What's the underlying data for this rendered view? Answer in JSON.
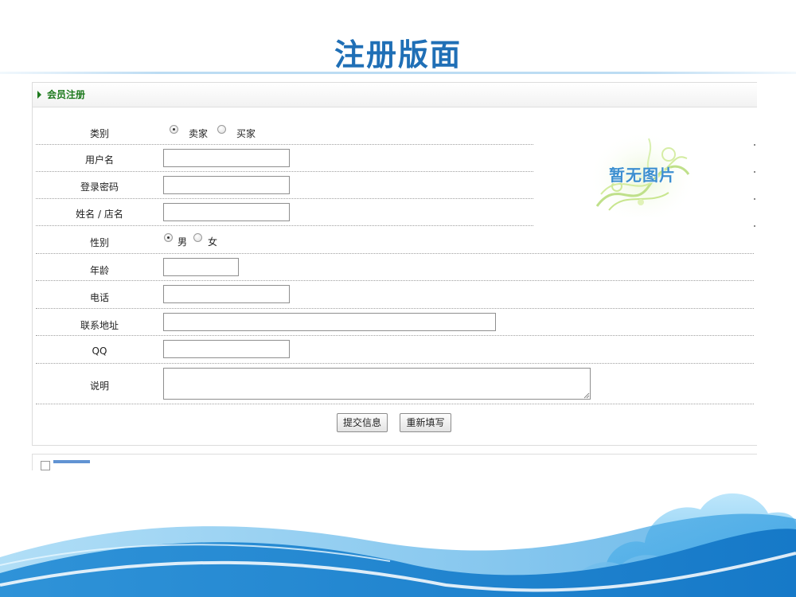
{
  "slide": {
    "title": "注册版面"
  },
  "panel": {
    "header": "会员注册"
  },
  "form": {
    "category": {
      "label": "类别",
      "options": [
        "卖家",
        "买家"
      ],
      "selected": "卖家"
    },
    "username": {
      "label": "用户名",
      "value": ""
    },
    "password": {
      "label": "登录密码",
      "value": ""
    },
    "name": {
      "label": "姓名 / 店名",
      "value": ""
    },
    "gender": {
      "label": "性别",
      "options": [
        "男",
        "女"
      ],
      "selected": "男"
    },
    "age": {
      "label": "年龄",
      "value": ""
    },
    "phone": {
      "label": "电话",
      "value": ""
    },
    "address": {
      "label": "联系地址",
      "value": ""
    },
    "qq": {
      "label": "QQ",
      "value": ""
    },
    "description": {
      "label": "说明",
      "value": ""
    },
    "submit_label": "提交信息",
    "reset_label": "重新填写"
  },
  "image_placeholder": {
    "text": "暂无图片"
  },
  "colors": {
    "title": "#1f6fb6",
    "header_text": "#1e7a1e",
    "sky_wave": "#3aa6e6"
  }
}
